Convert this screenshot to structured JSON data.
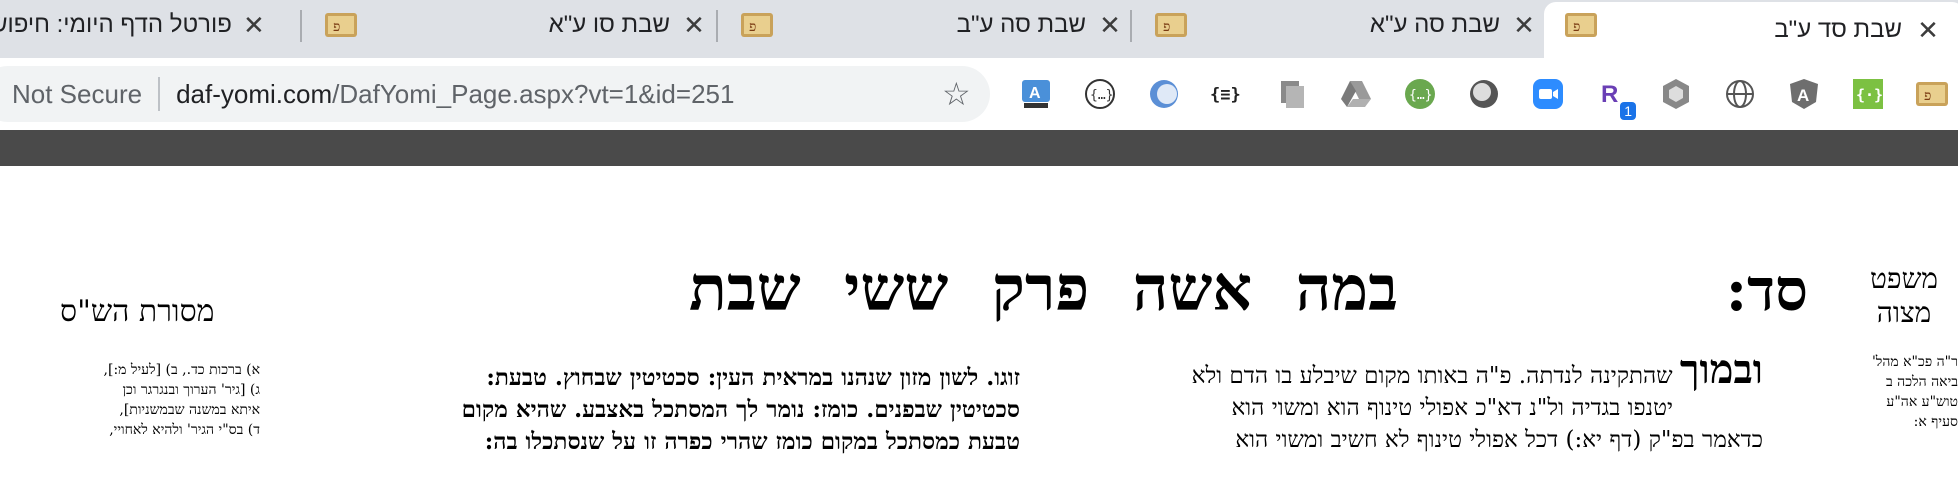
{
  "browser": {
    "tabs": [
      {
        "title": "פורטל הדף היומי: חיפוש",
        "active": false
      },
      {
        "title": "שבת סו ע\"א",
        "active": false
      },
      {
        "title": "שבת סה ע\"ב",
        "active": false
      },
      {
        "title": "שבת סה ע\"א",
        "active": false
      },
      {
        "title": "שבת סד ע\"ב",
        "active": true
      }
    ],
    "close_glyph": "✕",
    "security_label": "Not Secure",
    "url_domain": "daf-yomi.com",
    "url_path": "/DafYomi_Page.aspx?vt=1&id=251",
    "bookmark_icon": "star-icon",
    "extensions": [
      {
        "name": "translate-ext-icon",
        "label": "A"
      },
      {
        "name": "json-viewer-icon",
        "label": "{…}"
      },
      {
        "name": "circle-ext-icon",
        "label": ""
      },
      {
        "name": "json-formatter-icon",
        "label": "{≡}"
      },
      {
        "name": "copy-ext-icon",
        "label": ""
      },
      {
        "name": "drive-icon",
        "label": ""
      },
      {
        "name": "green-json-icon",
        "label": "{…}"
      },
      {
        "name": "gray-circle-icon",
        "label": ""
      },
      {
        "name": "zoom-icon",
        "label": ""
      },
      {
        "name": "r-ext-icon",
        "label": "R",
        "badge": "1"
      },
      {
        "name": "hexagon-ext-icon",
        "label": ""
      },
      {
        "name": "globe-ext-icon",
        "label": ""
      },
      {
        "name": "angular-icon",
        "label": "A"
      },
      {
        "name": "green-brackets-icon",
        "label": "{·}"
      },
      {
        "name": "daf-yomi-ext-icon",
        "label": ""
      }
    ],
    "colors": {
      "tabstrip": "#dee1e6",
      "omnibox": "#f1f3f4",
      "darkbar": "#4a4a4a"
    }
  },
  "page": {
    "daf_number": "סד:",
    "running_head": "במה אשה פרק ששי שבת",
    "mishpat_line1": "משפט",
    "mishpat_line2": "מצוה",
    "masoret": "מסורת הש\"ס",
    "rashi": {
      "lead": "ובמוך",
      "line1": "שהתקינה לנדתה. פ\"ה באותו מקום שיבלע בו הדם ולא",
      "line2": "יטנפו בגדיה ול\"נ דא\"כ אפולי טינוף הוא ומשוי הוא",
      "line3": "כדאמר בפ\"ק (דף יא:) דכל אפולי טינוף לא חשיב ומשוי הוא"
    },
    "tosafot": {
      "line1": "זוגו. לשון מזון שנהנו במראית העין: סכטיטין שבחוץ. טבעת:",
      "line2": "סכטיטין שבפנים. כומז: נומר לך המסתכל באצבע. שהיא מקום",
      "line3": "טבעת כמסתכל במקום כומז שהרי כפרה זו על שנסתכלו בה:"
    },
    "left_notes": {
      "line1": "א) ברכות כד., ב) [לעיל מ:],",
      "line2": "ג) [גיר' הערוך ובנגרגר וכן",
      "line3": "איתא במשנה שבמשניות],",
      "line4": "ד) בס\"י הגיר' ולהיא לאחויי,"
    },
    "right_notes": {
      "line1": "ר\"ה פכ\"א מהל'",
      "line2": "ביאה הלכה ב",
      "line3": "טוש\"ע אה\"ע",
      "line4": "סעיף א:"
    }
  }
}
